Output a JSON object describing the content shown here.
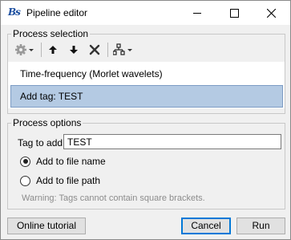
{
  "window": {
    "title": "Pipeline editor",
    "logo_text": "Bs",
    "controls": [
      "minimize-icon",
      "maximize-icon",
      "close-icon"
    ]
  },
  "process_selection": {
    "title": "Process selection",
    "toolbar": [
      "gear-icon",
      "move-up-icon",
      "move-down-icon",
      "delete-icon",
      "pipeline-tree-icon"
    ],
    "items": [
      {
        "label": "Time-frequency (Morlet wavelets)",
        "selected": false
      },
      {
        "label": "Add tag: TEST",
        "selected": true
      }
    ]
  },
  "process_options": {
    "title": "Process options",
    "tag_label": "Tag to add:",
    "tag_value": "TEST",
    "radio_file_name": "Add to file name",
    "radio_file_path": "Add to file path",
    "radio_selected": "file_name",
    "warning": "Warning: Tags cannot contain square brackets."
  },
  "buttons": {
    "tutorial": "Online tutorial",
    "cancel": "Cancel",
    "run": "Run"
  },
  "colors": {
    "selection_bg": "#b4cae3",
    "focus_border": "#0078d7",
    "logo": "#1c4fa0"
  }
}
